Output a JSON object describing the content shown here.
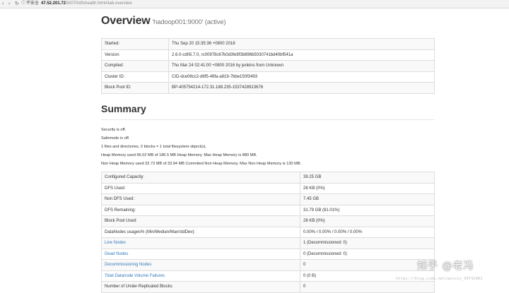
{
  "browser": {
    "back_glyph": "‹",
    "forward_glyph": "›",
    "reload_glyph": "↻",
    "info_glyph": "ⓘ",
    "insecure_label": "不安全",
    "url_host": "47.52.201.72",
    "url_path": ":50070/dfshealth.html#tab-overview"
  },
  "overview": {
    "title": "Overview",
    "subtitle": "'hadoop001:9000' (active)",
    "rows": [
      {
        "key": "Started:",
        "value": "Thu Sep 20 15:35:36 +0800 2018"
      },
      {
        "key": "Version:",
        "value": "2.6.0-cdh5.7.0, rc00978c67b0d3fe9f3b896b5030741bd40bf541a"
      },
      {
        "key": "Compiled:",
        "value": "Thu Mar 24 02:41:00 +0800 2016 by jenkins from Unknown"
      },
      {
        "key": "Cluster ID:",
        "value": "CID-dce08cc2-d6f5-49fa-a819-7bbe150f3493"
      },
      {
        "key": "Block Pool ID:",
        "value": "BP-405754214-172.31.188.235-1537428913676"
      }
    ]
  },
  "summary": {
    "title": "Summary",
    "lines": [
      "Security is off.",
      "Safemode is off.",
      "1 files and directories, 0 blocks = 1 total filesystem object(s).",
      "Heap Memory used 96.02 MB of 186.5 MB Heap Memory. Max Heap Memory is 889 MB.",
      "Non Heap Memory used 32.73 MB of 33.94 MB Commited Non Heap Memory. Max Non Heap Memory is 130 MB."
    ],
    "rows": [
      {
        "key": "Configured Capacity:",
        "value": "39.25 GB"
      },
      {
        "key": "DFS Used:",
        "value": "28 KB (0%)"
      },
      {
        "key": "Non DFS Used:",
        "value": "7.45 GB"
      },
      {
        "key": "DFS Remaining:",
        "value": "31.79 GB (81.01%)"
      },
      {
        "key": "Block Pool Used:",
        "value": "28 KB (0%)"
      },
      {
        "key": "DataNodes usages% (Min/Median/Max/stdDev):",
        "value": "0.00% / 0.00% / 0.00% / 0.00%"
      },
      {
        "key": "Live Nodes",
        "value": "1 (Decommissioned: 0)"
      },
      {
        "key": "Dead Nodes",
        "value": "0 (Decommissioned: 0)"
      },
      {
        "key": "Decommissioning Nodes",
        "value": "0"
      },
      {
        "key": "Total Datanode Volume Failures",
        "value": "0 (0 B)"
      },
      {
        "key": "Number of Under-Replicated Blocks",
        "value": "0"
      }
    ]
  },
  "watermark": {
    "main": "知乎 @老冯",
    "sub": "https://blog.csdn.net/weixin_39742901"
  }
}
